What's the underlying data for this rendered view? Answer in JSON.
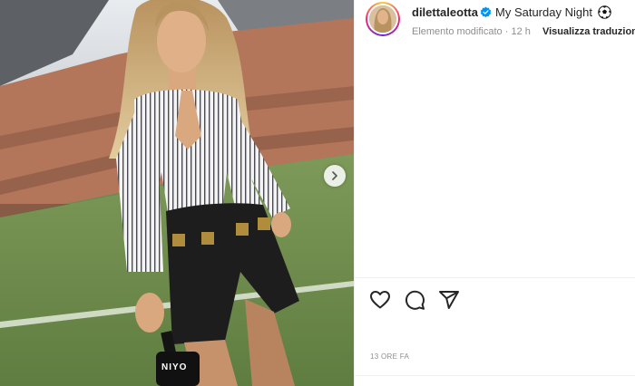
{
  "post": {
    "username": "dilettaleotta",
    "caption": "My Saturday Night",
    "edited_label": "Elemento modificato",
    "time_ago": "12 h",
    "translate_label": "Visualizza traduzione",
    "timestamp": "13 ORE FA"
  },
  "media": {
    "mic_label": "NIYO"
  },
  "icons": {
    "verified": "verified-badge-icon",
    "ball": "soccer-ball-icon",
    "like": "heart-icon",
    "comment": "comment-icon",
    "share": "paper-plane-icon",
    "next": "chevron-right-icon"
  },
  "colors": {
    "verified_blue": "#0095f6",
    "text_primary": "#262626",
    "text_secondary": "#8e8e8e"
  }
}
